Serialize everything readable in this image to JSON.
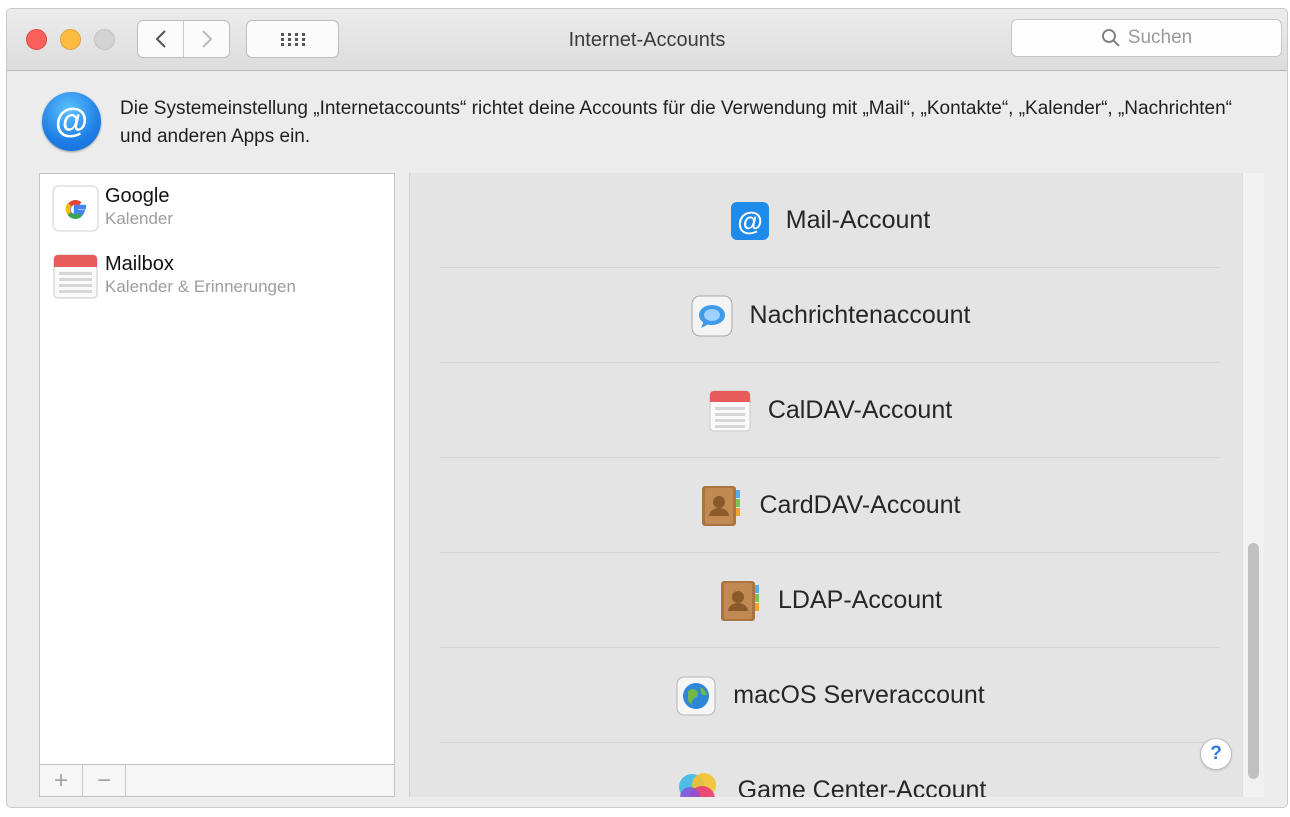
{
  "window": {
    "title": "Internet-Accounts"
  },
  "search": {
    "placeholder": "Suchen"
  },
  "header": {
    "description": "Die Systemeinstellung „Internetaccounts“ richtet deine Accounts für die Verwendung mit „Mail“, „Kontakte“, „Kalender“, „Nachrichten“ und anderen Apps ein."
  },
  "sidebar": {
    "accounts": [
      {
        "name": "Google",
        "detail": "Kalender",
        "icon": "google-icon"
      },
      {
        "name": "Mailbox",
        "detail": "Kalender & Erinnerungen",
        "icon": "calendar-icon"
      }
    ],
    "add_label": "+",
    "remove_label": "−"
  },
  "providers": [
    {
      "label": "Mail-Account",
      "icon": "mail-at-icon"
    },
    {
      "label": "Nachrichtenaccount",
      "icon": "messages-icon"
    },
    {
      "label": "CalDAV-Account",
      "icon": "calendar-icon"
    },
    {
      "label": "CardDAV-Account",
      "icon": "contacts-book-icon"
    },
    {
      "label": "LDAP-Account",
      "icon": "contacts-book-icon"
    },
    {
      "label": "macOS Serveraccount",
      "icon": "globe-icon"
    },
    {
      "label": "Game Center-Account",
      "icon": "game-center-icon"
    }
  ],
  "help": {
    "label": "?"
  },
  "colors": {
    "accent": "#1e7fe6",
    "close": "#fc605b",
    "minimize": "#fdbc40",
    "zoom_disabled": "#d3d3d3"
  }
}
